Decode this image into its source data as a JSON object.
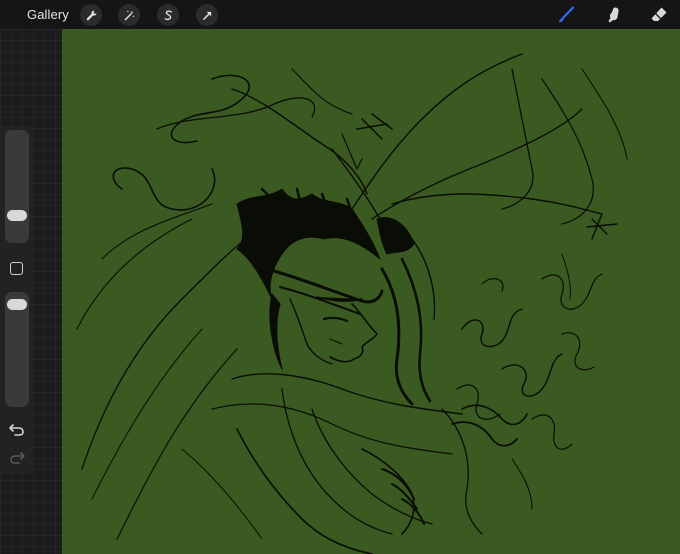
{
  "toolbar": {
    "gallery_label": "Gallery",
    "actions_icon": "wrench-icon",
    "adjustments_icon": "magic-wand-icon",
    "selection_icon": "selection-s-icon",
    "transform_icon": "arrow-cursor-icon",
    "brush_icon": "brush-icon",
    "smudge_icon": "smudge-finger-icon",
    "eraser_icon": "eraser-icon",
    "active_tool": "brush",
    "active_color": "#2f6cf2"
  },
  "sidebar": {
    "brush_size": 0.2,
    "opacity": 0.95,
    "modify_icon": "square-modify-icon",
    "undo_icon": "undo-icon",
    "redo_icon": "redo-icon"
  },
  "canvas": {
    "background_color": "#3b5a21",
    "stroke_color": "#0a0d06"
  }
}
